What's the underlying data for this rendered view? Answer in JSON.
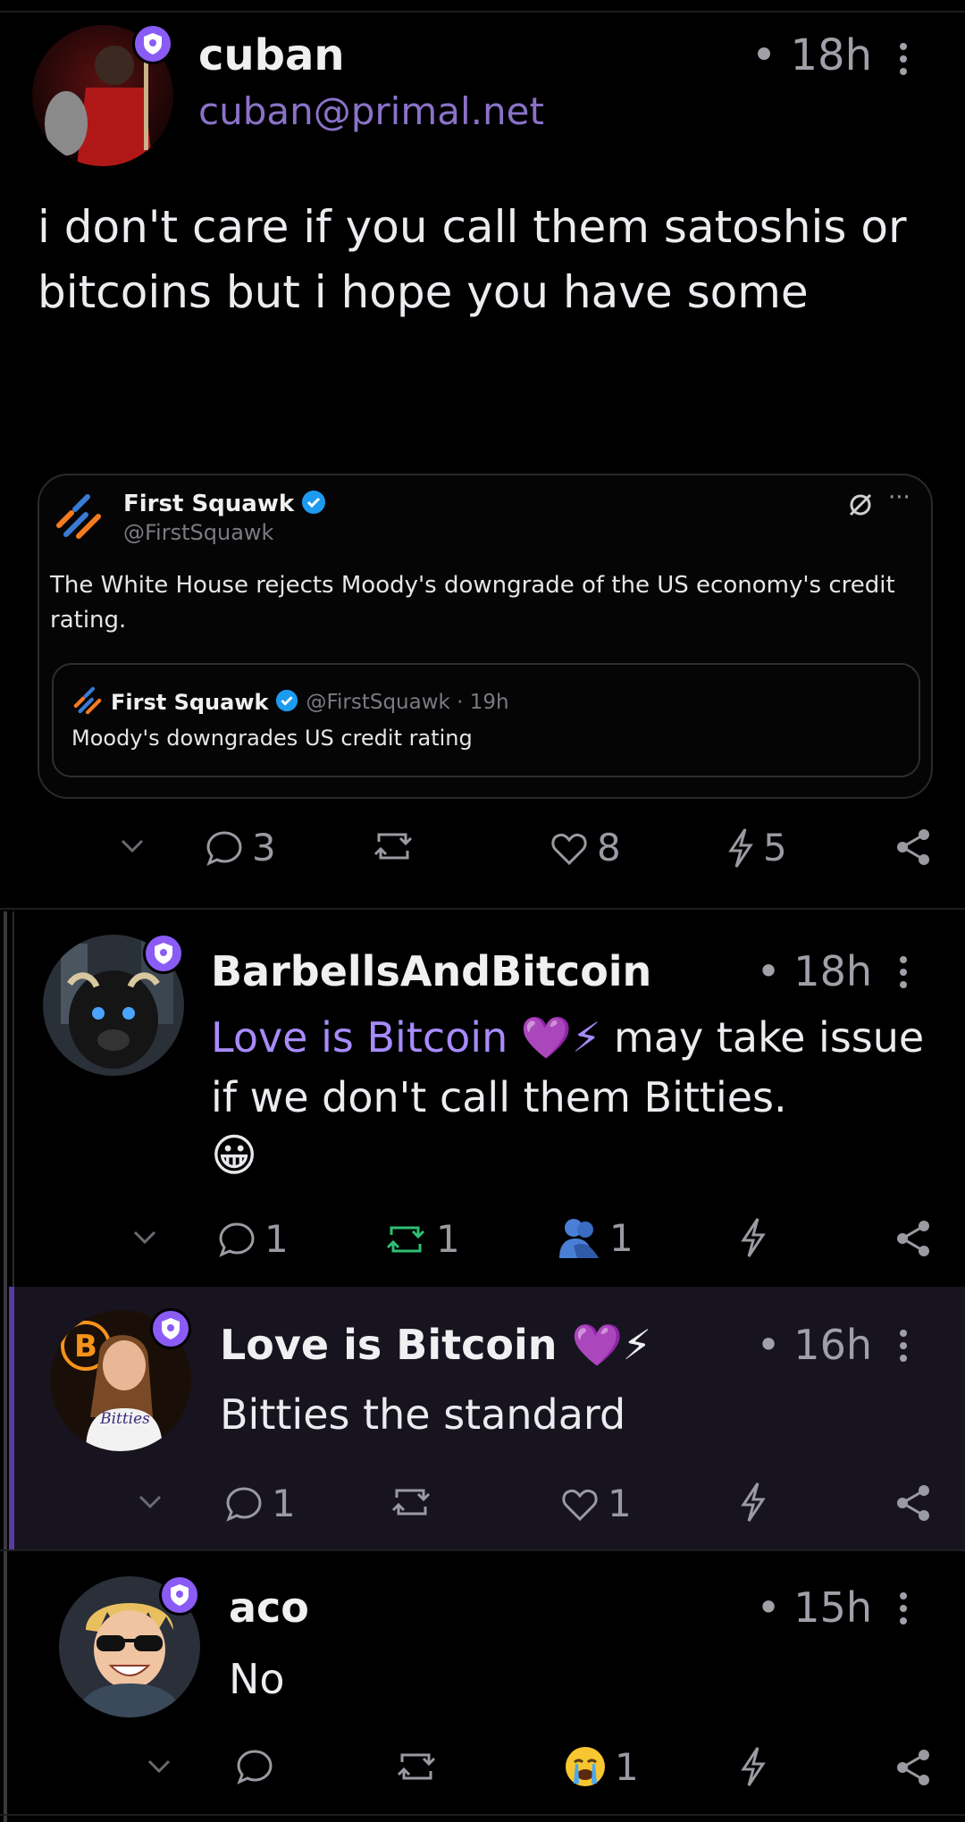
{
  "posts": [
    {
      "name": "cuban",
      "handle": "cuban@primal.net",
      "time": "• 18h",
      "text": "i don't care if you call them satoshis or bitcoins but i hope you have some",
      "quote": {
        "name": "First Squawk",
        "handle": "@FirstSquawk",
        "text": "The White House rejects Moody's downgrade of the US economy's credit rating.",
        "inner_name": "First Squawk",
        "inner_meta": "@FirstSquawk · 19h",
        "inner_text": "Moody's downgrades US credit rating"
      },
      "actions": {
        "replies": "3",
        "likes": "8",
        "zaps": "5"
      }
    },
    {
      "name": "BarbellsAndBitcoin",
      "time": "• 18h",
      "mention": "Love is Bitcoin 💜⚡",
      "text": " may take issue if we don't call them Bitties.",
      "emoji": "😀",
      "actions": {
        "replies": "1",
        "reposts": "1",
        "reactions": "1"
      }
    },
    {
      "name": "Love is Bitcoin 💜⚡",
      "time": "• 16h",
      "text": "Bitties the standard",
      "avatar_shirt_text": "Bitties",
      "actions": {
        "replies": "1",
        "likes": "1"
      }
    },
    {
      "name": "aco",
      "time": "• 15h",
      "text": "No",
      "actions": {
        "reactions": "1"
      }
    }
  ],
  "colors": {
    "accent": "#8a5cf5",
    "mention": "#a78bfa",
    "repost_active": "#2fbf71"
  }
}
